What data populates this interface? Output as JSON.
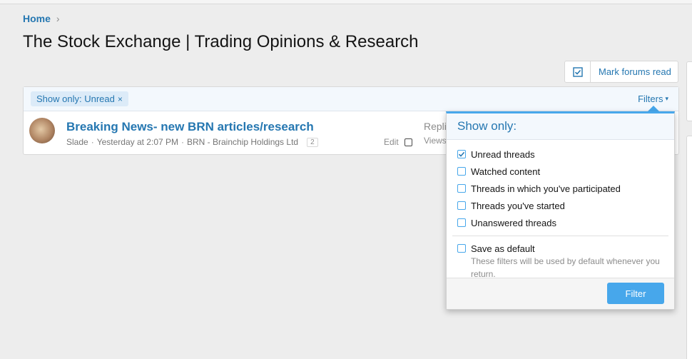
{
  "breadcrumb": {
    "home": "Home",
    "chevron": "›"
  },
  "page": {
    "title": "The Stock Exchange | Trading Opinions & Research"
  },
  "toolbar": {
    "mark_read_label": "Mark forums read",
    "mark_read_icon": "check-square-icon"
  },
  "filter_bar": {
    "chip_label": "Show only: Unread",
    "chip_remove": "×",
    "filters_label": "Filters",
    "filters_caret": "▾"
  },
  "thread": {
    "title": "Breaking News- new BRN articles/research",
    "author": "Slade",
    "sep1": "·",
    "date": "Yesterday at 2:07 PM",
    "sep2": "·",
    "forum": "BRN - Brainchip Holdings Ltd",
    "page_badge": "2",
    "edit_label": "Edit",
    "replies_label": "Repli",
    "views_label": "Views:"
  },
  "filter_menu": {
    "header": "Show only:",
    "options": [
      {
        "label": "Unread threads",
        "checked": true
      },
      {
        "label": "Watched content",
        "checked": false
      },
      {
        "label": "Threads in which you've participated",
        "checked": false
      },
      {
        "label": "Threads you've started",
        "checked": false
      },
      {
        "label": "Unanswered threads",
        "checked": false
      }
    ],
    "save_default_label": "Save as default",
    "save_default_hint": "These filters will be used by default whenever you return.",
    "submit_label": "Filter"
  },
  "colors": {
    "accent": "#47a7eb",
    "link": "#2577b1",
    "muted": "#8c8c8c"
  }
}
